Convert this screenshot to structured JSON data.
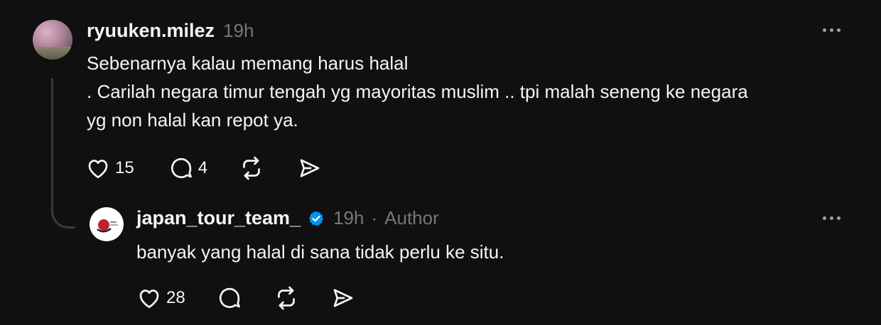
{
  "colors": {
    "background": "#101010",
    "text_primary": "#f3f5f7",
    "text_secondary": "#777777",
    "verified_blue": "#0095f6",
    "thread_line": "#3a3a3a"
  },
  "post": {
    "username": "ryuuken.milez",
    "time": "19h",
    "text": "Sebenarnya kalau memang harus halal\n. Carilah negara timur tengah yg mayoritas muslim .. tpi malah seneng ke negara\nyg non halal kan repot ya.",
    "likes": "15",
    "replies": "4",
    "icons": {
      "like": "heart-icon",
      "reply": "comment-icon",
      "repost": "repost-icon",
      "share": "send-icon",
      "more": "more-icon"
    }
  },
  "reply": {
    "username": "japan_tour_team_",
    "verified": true,
    "time": "19h",
    "separator": "·",
    "author_label": "Author",
    "text": "banyak yang halal di sana tidak perlu ke situ.",
    "likes": "28",
    "icons": {
      "like": "heart-icon",
      "reply": "comment-icon",
      "repost": "repost-icon",
      "share": "send-icon",
      "more": "more-icon"
    }
  }
}
